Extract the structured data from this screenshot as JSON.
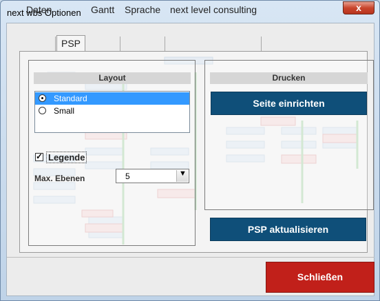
{
  "window": {
    "title": "next wbs Optionen",
    "close_glyph": "x"
  },
  "tabs": [
    {
      "label": "Daten"
    },
    {
      "label": "PSP"
    },
    {
      "label": "Gantt"
    },
    {
      "label": "Sprache"
    },
    {
      "label": "next level consulting"
    }
  ],
  "active_tab": "PSP",
  "layout": {
    "title": "Layout",
    "options": [
      {
        "label": "Standard",
        "selected": true
      },
      {
        "label": "Small",
        "selected": false
      }
    ],
    "legend_label": "Legende",
    "legend_checked": true,
    "max_levels_label": "Max. Ebenen",
    "max_levels_value": "5"
  },
  "print": {
    "title": "Drucken",
    "page_setup_button": "Seite einrichten"
  },
  "update_button": "PSP aktualisieren",
  "close_button": "Schließen",
  "colors": {
    "button_blue": "#0f4f79",
    "button_red": "#c1201a",
    "selection": "#3399ff"
  },
  "icons": {
    "close": "close-icon",
    "dropdown": "chevron-down-icon",
    "check": "checkmark-icon"
  }
}
